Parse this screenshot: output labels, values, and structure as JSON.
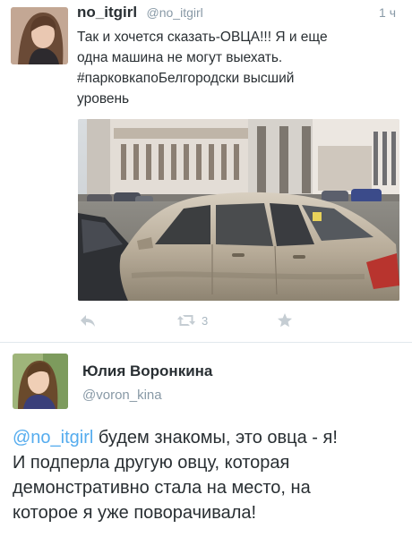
{
  "tweet1": {
    "display_name": "no_itgirl",
    "handle": "@no_itgirl",
    "time": "1 ч",
    "text_lines": [
      "Так и хочется сказать-ОВЦА!!! Я и еще",
      "одна машина не могут выехать.",
      "#парковкапоБелгородски высший",
      "уровень"
    ],
    "photo_icon": "car-parking-photo",
    "actions": {
      "reply_icon": "reply-icon",
      "retweet_icon": "retweet-icon",
      "retweet_count": "3",
      "favorite_icon": "star-icon"
    }
  },
  "tweet2": {
    "display_name": "Юлия Воронкина",
    "handle": "@voron_kina",
    "text": {
      "mention": "@no_itgirl",
      "line1_rest": " будем знакомы, это овца - я!",
      "line2": "И подперла  другую овцу, которая",
      "line3": "демонстративно стала на место, на",
      "line4": "которое я уже поворачивала!"
    }
  },
  "colors": {
    "link": "#55acee",
    "secondary_text": "#8899a6",
    "icon": "#aab8c2",
    "divider": "#e1e8ed",
    "text": "#292f33"
  }
}
